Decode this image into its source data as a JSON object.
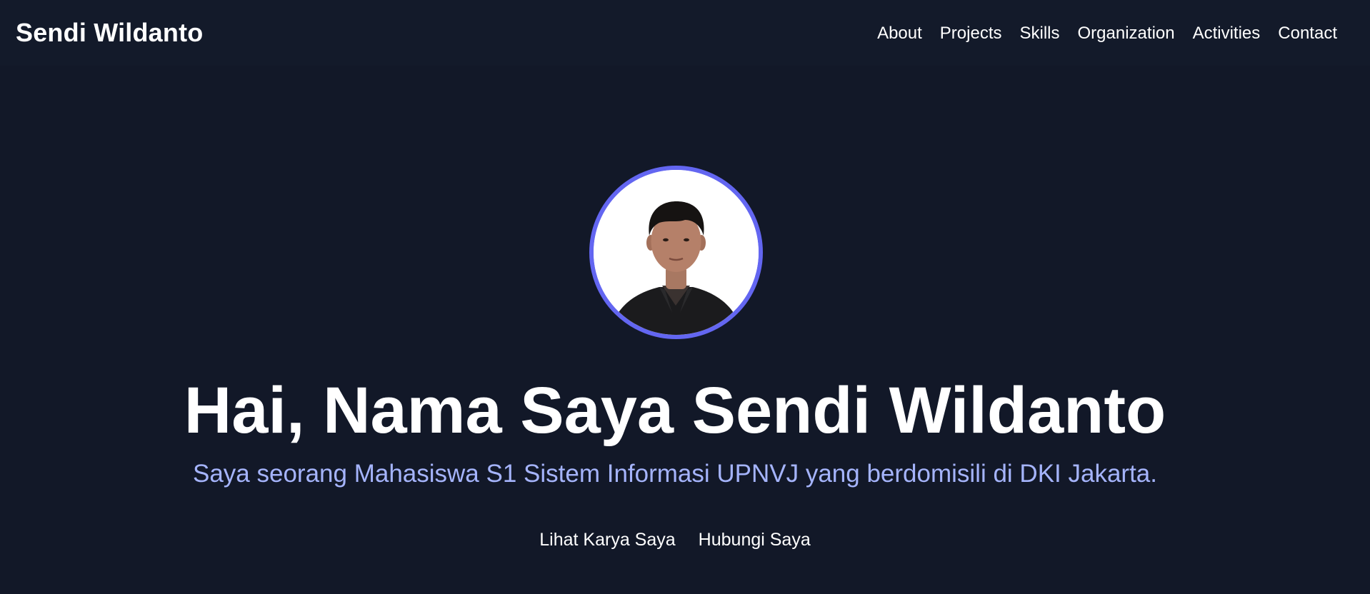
{
  "navbar": {
    "brand": "Sendi Wildanto",
    "links": [
      {
        "label": "About"
      },
      {
        "label": "Projects"
      },
      {
        "label": "Skills"
      },
      {
        "label": "Organization"
      },
      {
        "label": "Activities"
      },
      {
        "label": "Contact"
      }
    ]
  },
  "hero": {
    "title": "Hai, Nama Saya Sendi Wildanto",
    "subtitle": "Saya seorang Mahasiswa S1 Sistem Informasi UPNVJ yang berdomisili di DKI Jakarta.",
    "buttons": [
      {
        "label": "Lihat Karya Saya"
      },
      {
        "label": "Hubungi Saya"
      }
    ]
  },
  "colors": {
    "background": "#121828",
    "accent": "#6366f1",
    "subtitle": "#a5b4fc"
  }
}
